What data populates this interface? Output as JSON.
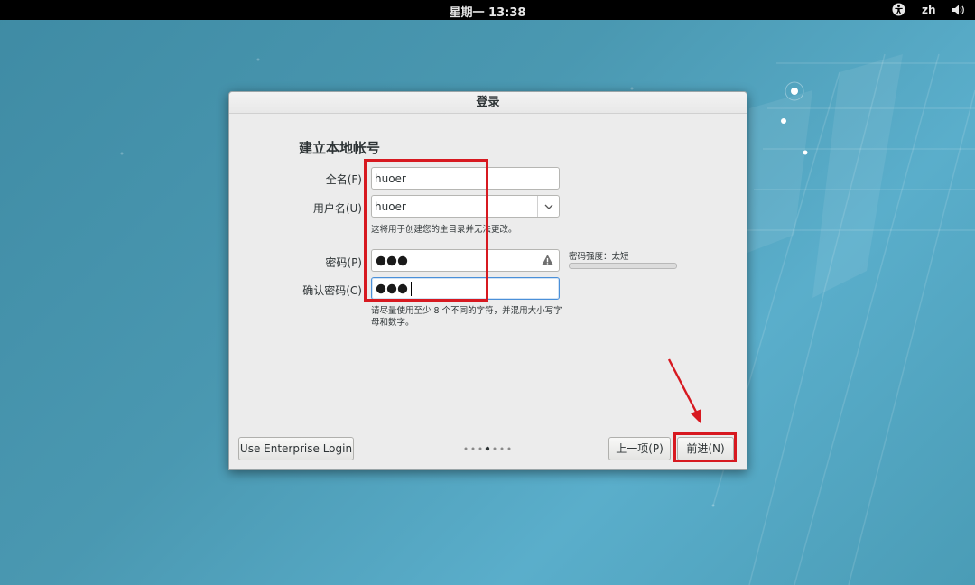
{
  "topbar": {
    "clock": "星期一 13:38",
    "language": "zh",
    "icons": [
      "accessibility-icon",
      "volume-icon"
    ]
  },
  "dialog": {
    "title": "登录",
    "heading": "建立本地帐号",
    "fields": {
      "fullname_label": "全名(F)",
      "fullname_value": "huoer",
      "username_label": "用户名(U)",
      "username_value": "huoer",
      "username_hint": "这将用于创建您的主目录并无法更改。",
      "password_label": "密码(P)",
      "confirm_label": "确认密码(C)",
      "password_hint": "请尽量使用至少 8 个不同的字符，并混用大小写字母和数字。"
    },
    "strength": {
      "label": "密码强度：太短",
      "level": 0
    },
    "buttons": {
      "enterprise": "Use Enterprise Login",
      "previous": "上一项(P)",
      "next": "前进(N)"
    },
    "pager": {
      "count": 7,
      "current": 4
    }
  },
  "colors": {
    "annotation": "#d71920",
    "focus": "#4a90d9",
    "background": "#4a98b1"
  }
}
